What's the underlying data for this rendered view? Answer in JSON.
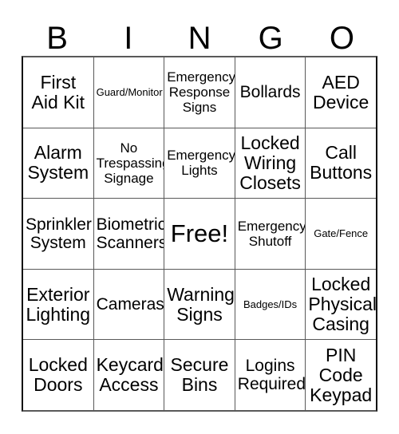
{
  "card": {
    "title": "BINGO",
    "header_letters": [
      "B",
      "I",
      "N",
      "G",
      "O"
    ],
    "free_space_label": "Free!",
    "grid": [
      [
        {
          "text": "First\nAid Kit",
          "size": "lg"
        },
        {
          "text": "Guard/Monitor",
          "size": "xs"
        },
        {
          "text": "Emergency\nResponse\nSigns",
          "size": "sm"
        },
        {
          "text": "Bollards",
          "size": "md"
        },
        {
          "text": "AED\nDevice",
          "size": "lg"
        }
      ],
      [
        {
          "text": "Alarm\nSystem",
          "size": "lg"
        },
        {
          "text": "No\nTrespassing\nSignage",
          "size": "sm"
        },
        {
          "text": "Emergency\nLights",
          "size": "sm"
        },
        {
          "text": "Locked\nWiring\nClosets",
          "size": "lg"
        },
        {
          "text": "Call\nButtons",
          "size": "lg"
        }
      ],
      [
        {
          "text": "Sprinkler\nSystem",
          "size": "md"
        },
        {
          "text": "Biometric\nScanners",
          "size": "md"
        },
        {
          "text": "Free!",
          "size": "free"
        },
        {
          "text": "Emergency\nShutoff",
          "size": "sm"
        },
        {
          "text": "Gate/Fence",
          "size": "xs"
        }
      ],
      [
        {
          "text": "Exterior\nLighting",
          "size": "lg"
        },
        {
          "text": "Cameras",
          "size": "md"
        },
        {
          "text": "Warning\nSigns",
          "size": "lg"
        },
        {
          "text": "Badges/IDs",
          "size": "xs"
        },
        {
          "text": "Locked\nPhysical\nCasing",
          "size": "lg"
        }
      ],
      [
        {
          "text": "Locked\nDoors",
          "size": "lg"
        },
        {
          "text": "Keycard\nAccess",
          "size": "lg"
        },
        {
          "text": "Secure\nBins",
          "size": "lg"
        },
        {
          "text": "Logins\nRequired",
          "size": "md"
        },
        {
          "text": "PIN\nCode\nKeypad",
          "size": "lg"
        }
      ]
    ],
    "colors": {
      "background": "#ffffff",
      "text": "#000000",
      "grid_line": "#595959",
      "grid_outer": "#0d0d0d"
    }
  }
}
